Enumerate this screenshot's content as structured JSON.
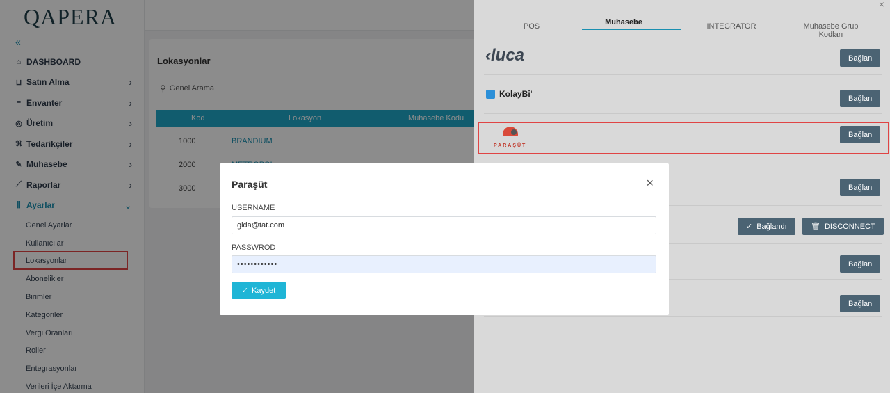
{
  "app": {
    "logo": "QAPERA",
    "collapse_glyph": "«"
  },
  "sidebar": {
    "items": [
      {
        "icon": "home-icon",
        "glyph": "⌂",
        "label": "DASHBOARD",
        "has_children": false
      },
      {
        "icon": "cart-icon",
        "glyph": "⊔",
        "label": "Satın Alma",
        "has_children": true
      },
      {
        "icon": "list-icon",
        "glyph": "≡",
        "label": "Envanter",
        "has_children": true
      },
      {
        "icon": "production-icon",
        "glyph": "◎",
        "label": "Üretim",
        "has_children": true
      },
      {
        "icon": "suppliers-icon",
        "glyph": "ℜ",
        "label": "Tedarikçiler",
        "has_children": true
      },
      {
        "icon": "accounting-icon",
        "glyph": "✎",
        "label": "Muhasebe",
        "has_children": true
      },
      {
        "icon": "chart-icon",
        "glyph": "⟋",
        "label": "Raporlar",
        "has_children": true
      },
      {
        "icon": "settings-sliders-icon",
        "glyph": "⫼",
        "label": "Ayarlar",
        "has_children": true,
        "expanded": true
      }
    ],
    "settings_children": [
      "Genel Ayarlar",
      "Kullanıcılar",
      "Lokasyonlar",
      "Abonelikler",
      "Birimler",
      "Kategoriler",
      "Vergi Oranları",
      "Roller",
      "Entegrasyonlar",
      "Verileri İçe Aktarma"
    ],
    "active_child": "Lokasyonlar"
  },
  "main": {
    "title": "Lokasyonlar",
    "search_placeholder": "Genel Arama",
    "columns": [
      "Kod",
      "Lokasyon",
      "Muhasebe Kodu"
    ],
    "rows": [
      {
        "kod": "1000",
        "lokasyon": "BRANDIUM"
      },
      {
        "kod": "2000",
        "lokasyon": "METROPOL"
      },
      {
        "kod": "3000",
        "lokasyon": ""
      }
    ]
  },
  "drawer": {
    "close_glyph": "×",
    "tabs": [
      "POS",
      "Muhasebe",
      "INTEGRATOR",
      "Muhasebe Grup Kodları"
    ],
    "active_tab": "Muhasebe",
    "integrations": [
      {
        "name": "luca",
        "button": "Bağlan"
      },
      {
        "name": "KolayBi'",
        "button": "Bağlan"
      },
      {
        "name": "PARAŞÜT",
        "button": "Bağlan"
      },
      {
        "name": "",
        "button": "Bağlan"
      },
      {
        "name": "",
        "button": "Bağlandı",
        "secondary_button": "DISCONNECT"
      },
      {
        "name": "",
        "button": "Bağlan"
      },
      {
        "name": "",
        "button": "Bağlan"
      }
    ]
  },
  "modal": {
    "title": "Paraşüt",
    "close_glyph": "×",
    "username_label": "USERNAME",
    "username_value": "gida@tat.com",
    "password_label": "PASSWROD",
    "password_value": "••••••••••••",
    "save_label": "Kaydet",
    "check_glyph": "✓"
  },
  "colors": {
    "accent": "#1fa8c9",
    "link": "#1a8fb0",
    "button_dark": "#4b6373",
    "highlight_red": "#e04444",
    "save_button": "#1fb5d6"
  }
}
